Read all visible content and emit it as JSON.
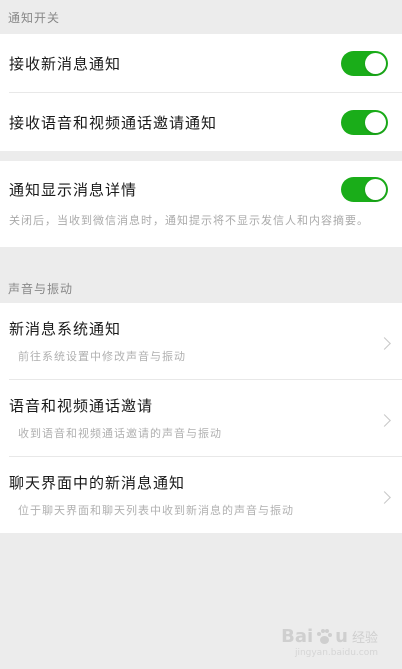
{
  "sections": {
    "notify_switch": {
      "header": "通知开关",
      "receive_new_msg": "接收新消息通知",
      "receive_call_invite": "接收语音和视频通话邀请通知"
    },
    "detail": {
      "title": "通知显示消息详情",
      "description": "关闭后，当收到微信消息时，通知提示将不显示发信人和内容摘要。"
    },
    "sound_vibration": {
      "header": "声音与振动",
      "items": [
        {
          "title": "新消息系统通知",
          "subtitle": "前往系统设置中修改声音与振动"
        },
        {
          "title": "语音和视频通话邀请",
          "subtitle": "收到语音和视频通话邀请的声音与振动"
        },
        {
          "title": "聊天界面中的新消息通知",
          "subtitle": "位于聊天界面和聊天列表中收到新消息的声音与振动"
        }
      ]
    }
  },
  "toggles": {
    "receive_new_msg": true,
    "receive_call_invite": true,
    "show_detail": true
  },
  "colors": {
    "toggle_on": "#1aad19",
    "background": "#ececec"
  },
  "watermark": {
    "brand_left": "Bai",
    "brand_right": "u",
    "brand_sub": "经验",
    "url": "jingyan.baidu.com"
  }
}
